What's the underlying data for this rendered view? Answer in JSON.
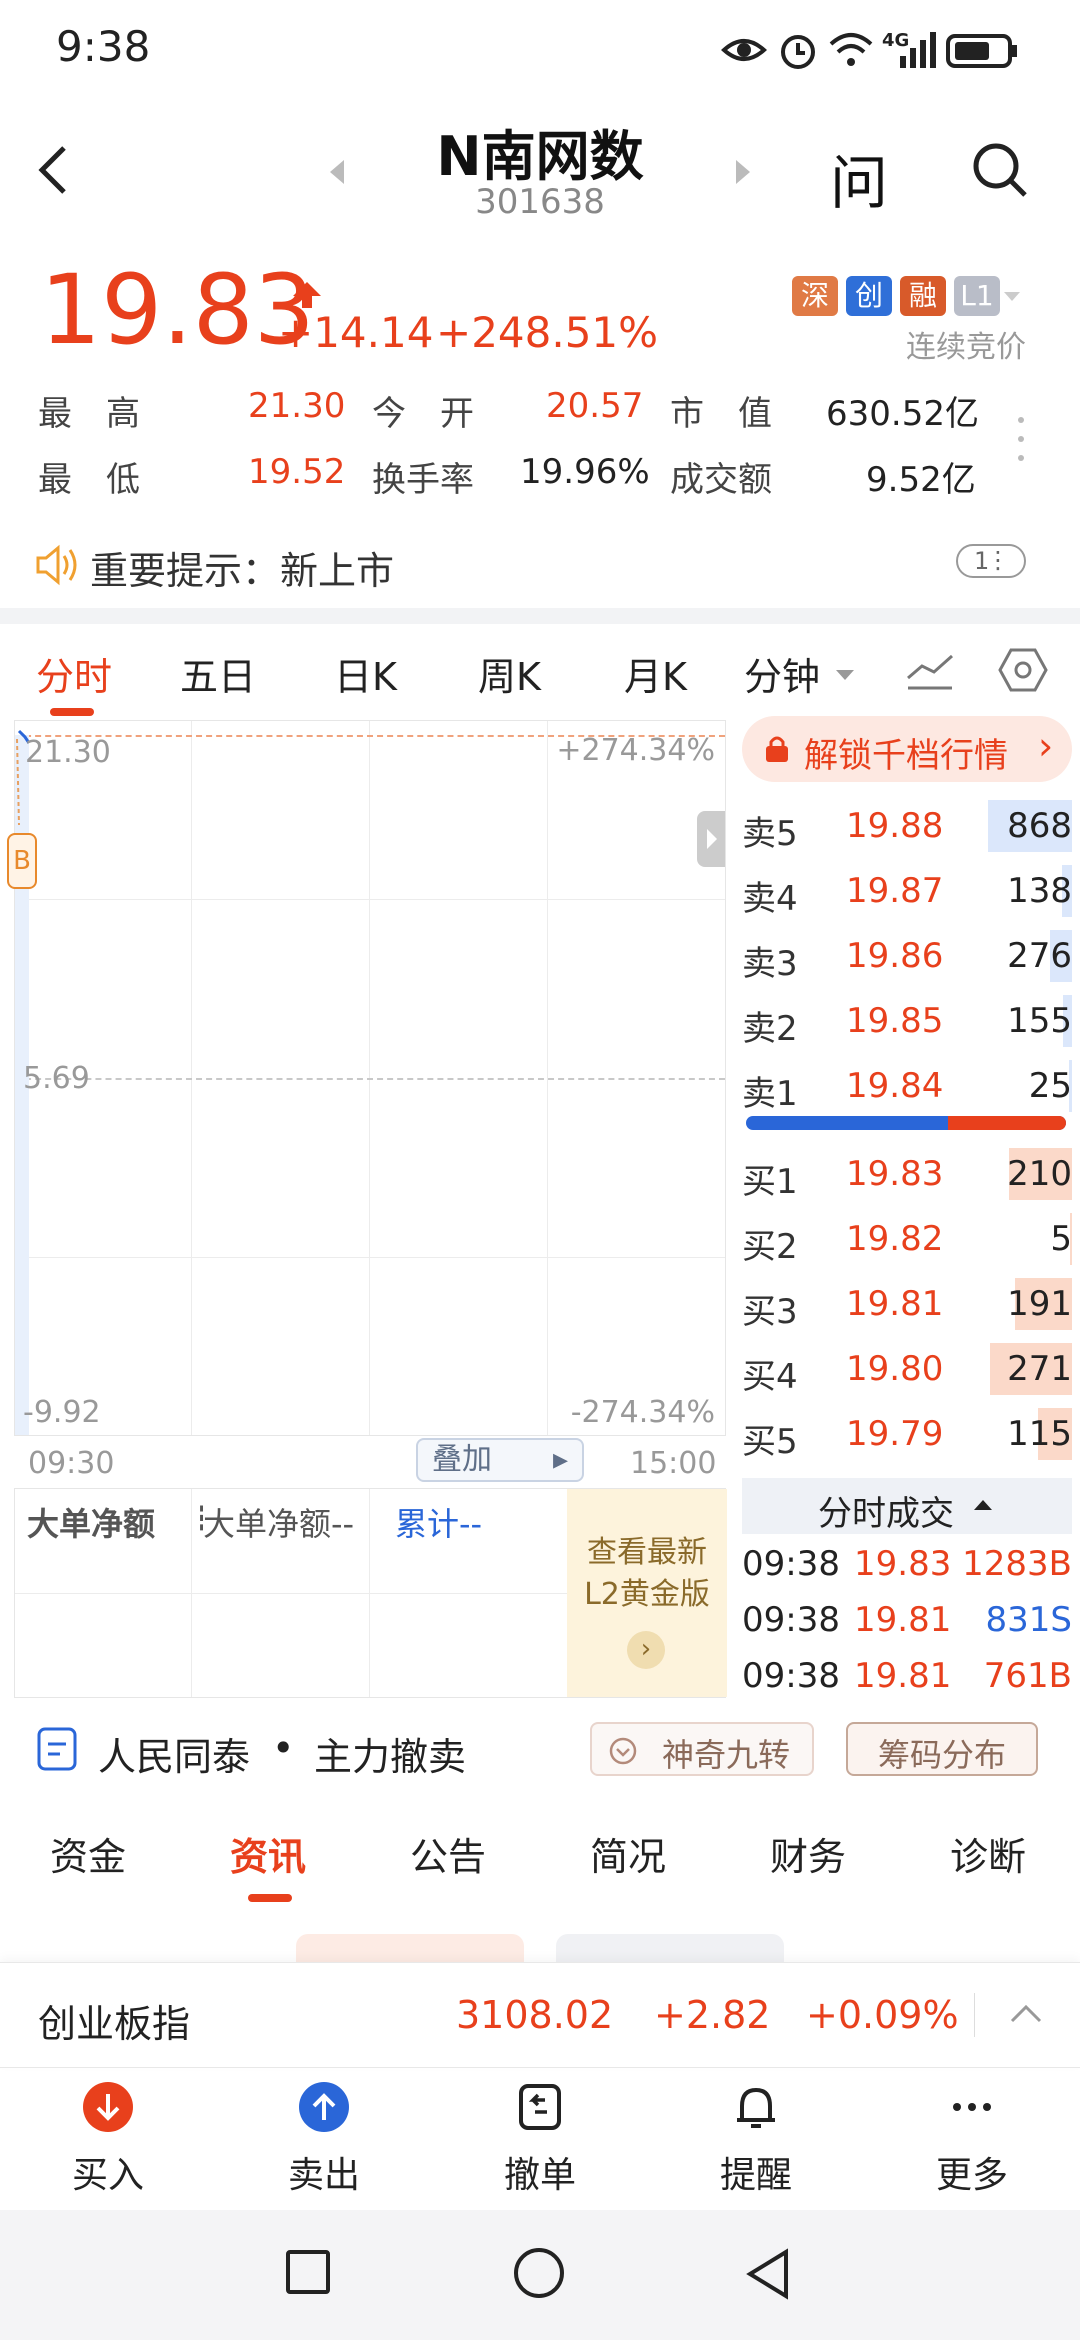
{
  "status_bar": {
    "time": "9:38",
    "network": "4G"
  },
  "header": {
    "title": "N南网数",
    "code": "301638",
    "ask_label": "问"
  },
  "quote": {
    "price": "19.83",
    "change": "+14.14",
    "change_pct": "+248.51%",
    "tags": [
      "深",
      "创",
      "融",
      "L1"
    ],
    "auction_label": "连续竞价",
    "stats": [
      {
        "label": "最　高",
        "value": "21.30"
      },
      {
        "label": "今　开",
        "value": "20.57"
      },
      {
        "label": "市　值",
        "value": "630.52亿"
      },
      {
        "label": "最　低",
        "value": "19.52"
      },
      {
        "label": "换手率",
        "value": "19.96%"
      },
      {
        "label": "成交额",
        "value": "9.52亿"
      }
    ]
  },
  "notice": {
    "text": "重要提示：新上市",
    "badge": "1"
  },
  "chart_tabs": [
    "分时",
    "五日",
    "日K",
    "周K",
    "月K",
    "分钟"
  ],
  "chart": {
    "y_top": "21.30",
    "y_mid": "5.69",
    "y_bottom": "-9.92",
    "pct_top": "+274.34%",
    "pct_bottom": "-274.34%",
    "time_start": "09:30",
    "time_end": "15:00",
    "overlay_label": "叠加",
    "marker": "B"
  },
  "big_order": {
    "title": "大单净额",
    "value_label": "大单净额--",
    "cum_label": "累计--"
  },
  "l2_promo": {
    "line1": "查看最新",
    "line2": "L2黄金版"
  },
  "order_book": {
    "unlock_label": "解锁千档行情",
    "asks": [
      {
        "label": "卖5",
        "price": "19.88",
        "volume": "868",
        "bar": 0.98
      },
      {
        "label": "卖4",
        "price": "19.87",
        "volume": "138",
        "bar": 0.12
      },
      {
        "label": "卖3",
        "price": "19.86",
        "volume": "276",
        "bar": 0.25
      },
      {
        "label": "卖2",
        "price": "19.85",
        "volume": "155",
        "bar": 0.1
      },
      {
        "label": "卖1",
        "price": "19.84",
        "volume": "25",
        "bar": 0.04
      }
    ],
    "buy_ratio": 0.63,
    "bids": [
      {
        "label": "买1",
        "price": "19.83",
        "volume": "210",
        "bar": 0.73
      },
      {
        "label": "买2",
        "price": "19.82",
        "volume": "5",
        "bar": 0.02
      },
      {
        "label": "买3",
        "price": "19.81",
        "volume": "191",
        "bar": 0.66
      },
      {
        "label": "买4",
        "price": "19.80",
        "volume": "271",
        "bar": 0.95
      },
      {
        "label": "买5",
        "price": "19.79",
        "volume": "115",
        "bar": 0.4
      }
    ]
  },
  "ticks": {
    "title": "分时成交",
    "rows": [
      {
        "time": "09:38",
        "price": "19.83",
        "vol": "1283B",
        "side": "B"
      },
      {
        "time": "09:38",
        "price": "19.81",
        "vol": "831S",
        "side": "S"
      },
      {
        "time": "09:38",
        "price": "19.81",
        "vol": "761B",
        "side": "B"
      }
    ]
  },
  "strategy_bar": {
    "left": "人民同泰",
    "dot": "•",
    "right": "主力撤卖",
    "btn1": "神奇九转",
    "btn2": "筹码分布"
  },
  "bottom_tabs": [
    "资金",
    "资讯",
    "公告",
    "简况",
    "财务",
    "诊断"
  ],
  "index_bar": {
    "name": "创业板指",
    "value": "3108.02",
    "change": "+2.82",
    "change_pct": "+0.09%"
  },
  "bottom_nav": [
    {
      "label": "买入",
      "icon": "buy-icon"
    },
    {
      "label": "卖出",
      "icon": "sell-icon"
    },
    {
      "label": "撤单",
      "icon": "cancel-order-icon"
    },
    {
      "label": "提醒",
      "icon": "bell-icon"
    },
    {
      "label": "更多",
      "icon": "more-icon"
    }
  ],
  "colors": {
    "up": "#e8401c",
    "down": "#2a66d8",
    "ask_bar": "#dbe7fb",
    "bid_bar": "#fbd9c9"
  }
}
